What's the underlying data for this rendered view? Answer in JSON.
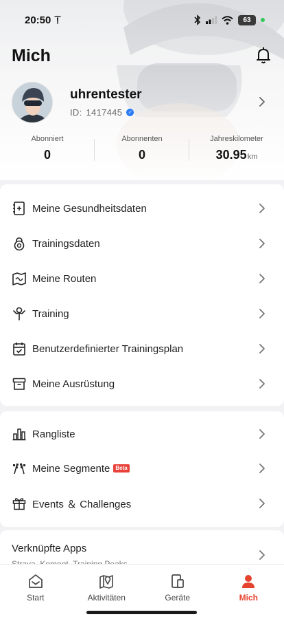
{
  "status_bar": {
    "time": "20:50",
    "battery": "63"
  },
  "header": {
    "title": "Mich"
  },
  "profile": {
    "username": "uhrentester",
    "id_label": "ID:",
    "id_value": "1417445",
    "gender_symbol": "♂"
  },
  "stats": [
    {
      "label": "Abonniert",
      "value": "0",
      "unit": ""
    },
    {
      "label": "Abonnenten",
      "value": "0",
      "unit": ""
    },
    {
      "label": "Jahreskilometer",
      "value": "30.95",
      "unit": "km"
    }
  ],
  "menu_group_1": [
    {
      "label": "Meine Gesundheitsdaten",
      "icon": "health-data-icon"
    },
    {
      "label": "Trainingsdaten",
      "icon": "kettlebell-icon"
    },
    {
      "label": "Meine Routen",
      "icon": "map-icon"
    },
    {
      "label": "Training",
      "icon": "coach-icon"
    },
    {
      "label": "Benutzerdefinierter Trainingsplan",
      "icon": "calendar-check-icon"
    },
    {
      "label": "Meine Ausrüstung",
      "icon": "box-icon"
    }
  ],
  "menu_group_2": [
    {
      "label": "Rangliste",
      "icon": "bar-chart-icon"
    },
    {
      "label": "Meine Segmente",
      "icon": "checkered-flags-icon",
      "badge": "Beta"
    },
    {
      "label": "Events ＆ Challenges",
      "icon": "gift-icon"
    }
  ],
  "linked_apps": {
    "title": "Verknüpfte Apps",
    "subtitle": "Strava, Komoot, Training Peaks"
  },
  "tabbar": [
    {
      "label": "Start",
      "active": false
    },
    {
      "label": "Aktivitäten",
      "active": false
    },
    {
      "label": "Geräte",
      "active": false
    },
    {
      "label": "Mich",
      "active": true
    }
  ],
  "colors": {
    "accent": "#e5432d",
    "gender_badge": "#2f7df6",
    "beta_badge": "#e8423a"
  }
}
